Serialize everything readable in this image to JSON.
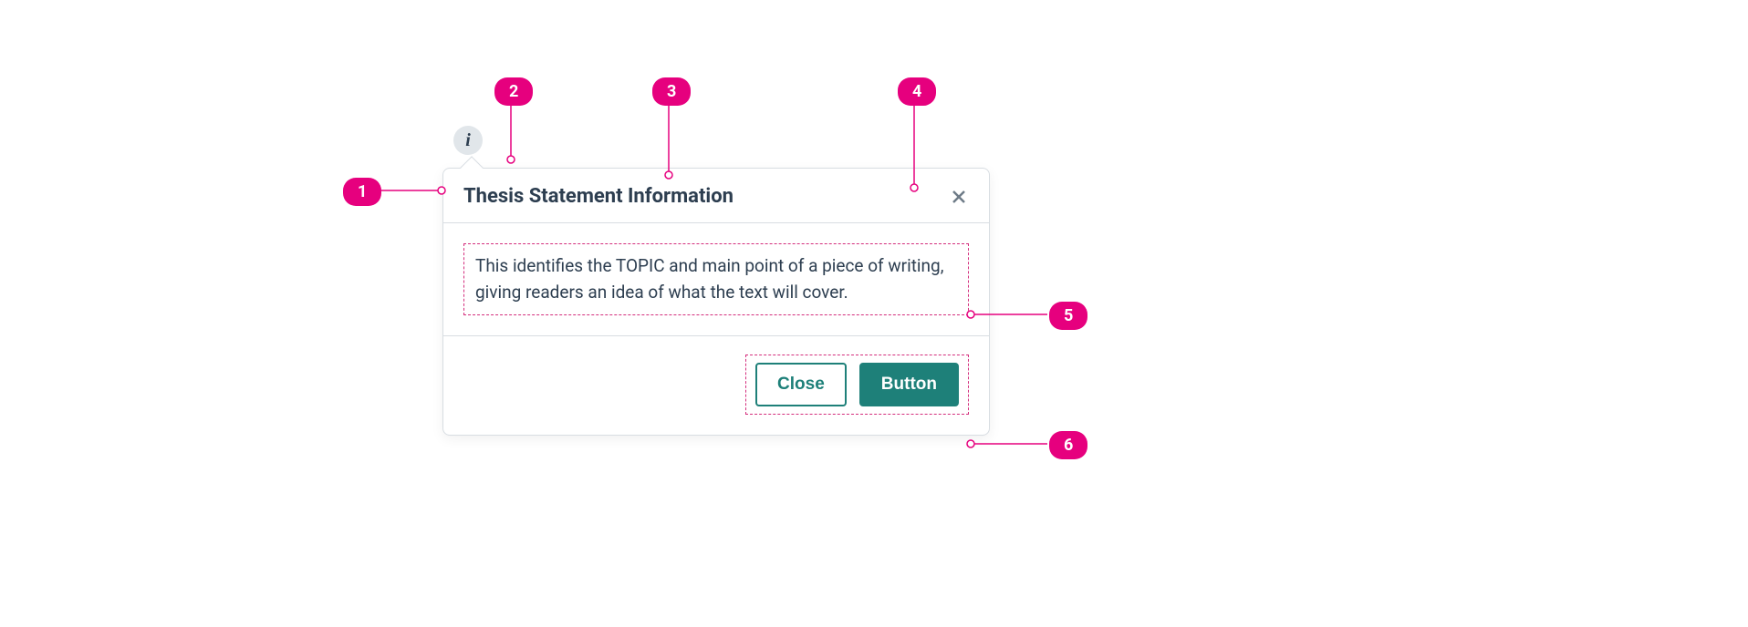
{
  "popover": {
    "trigger_icon": "i",
    "title": "Thesis Statement Information",
    "body_text": "This identifies the TOPIC and main point of a piece of writing, giving readers an idea of what the text will cover.",
    "buttons": {
      "close": "Close",
      "primary": "Button"
    }
  },
  "callouts": {
    "1": "1",
    "2": "2",
    "3": "3",
    "4": "4",
    "5": "5",
    "6": "6"
  },
  "colors": {
    "accent_pink": "#e6007e",
    "teal": "#1e8079",
    "text": "#2d3e50",
    "border": "#d8dde2"
  }
}
